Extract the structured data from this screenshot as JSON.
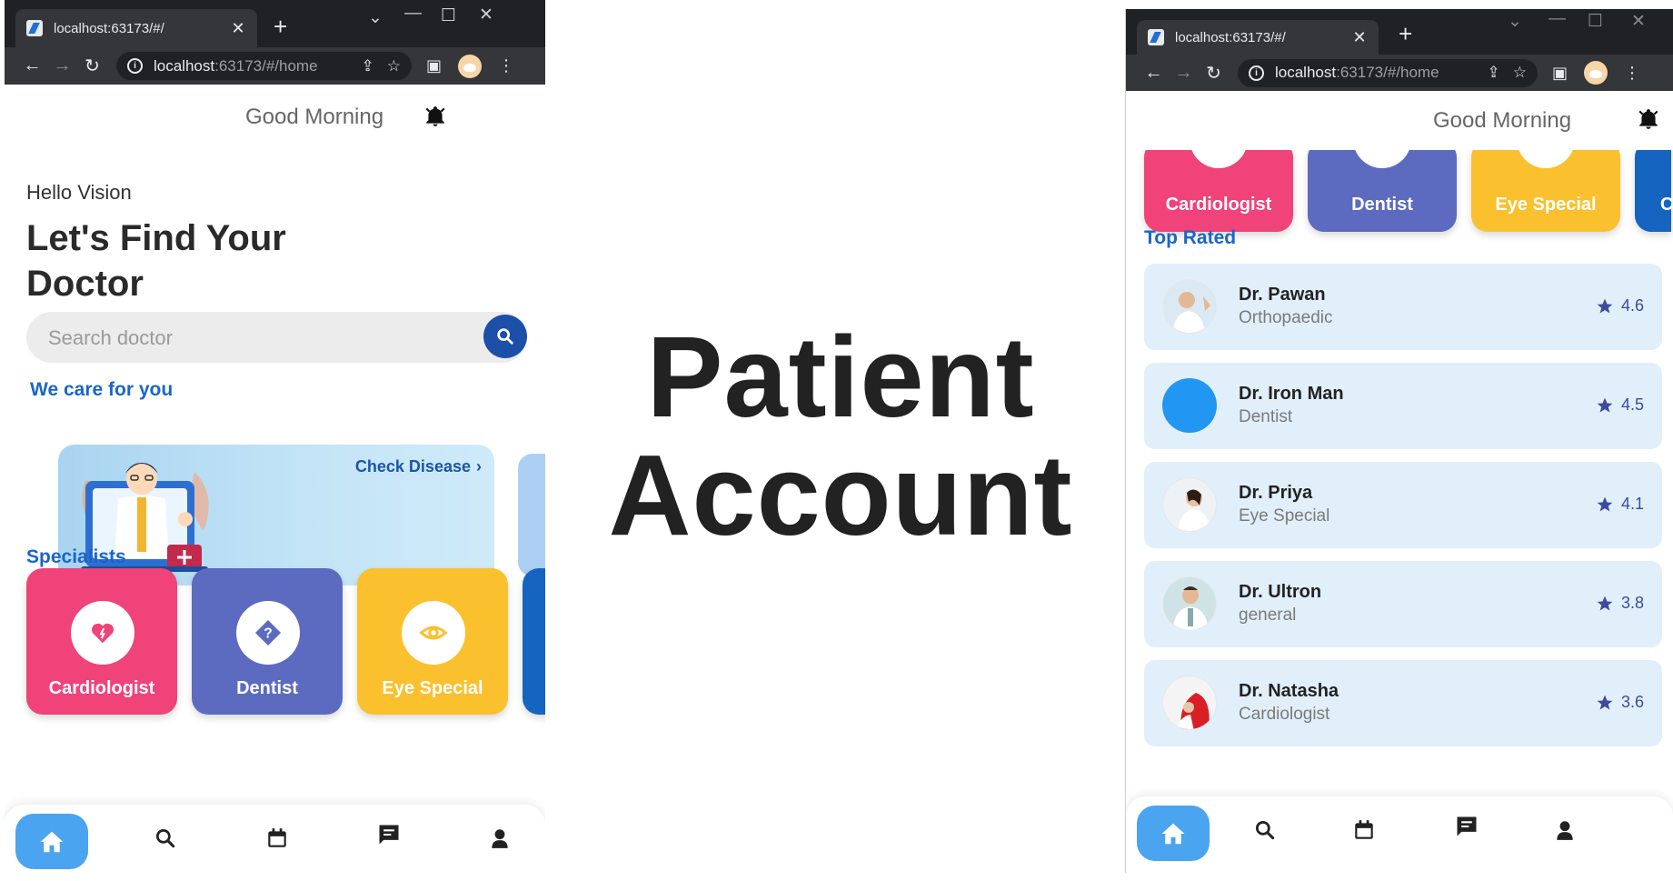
{
  "overlay_title": {
    "line1": "Patient",
    "line2": "Account"
  },
  "browser": {
    "tab_title": "localhost:63173/#/",
    "url_host": "localhost",
    "url_rest": ":63173/#/home"
  },
  "app": {
    "greeting": "Good Morning",
    "hello": "Hello Vision",
    "headline": "Let's Find Your Doctor",
    "search_placeholder": "Search doctor",
    "care_title": "We care for you",
    "check_disease": "Check Disease",
    "specialists_title": "Specialists",
    "specialists": [
      {
        "label": "Cardiologist",
        "color": "#ef4379"
      },
      {
        "label": "Dentist",
        "color": "#5c6bc0"
      },
      {
        "label": "Eye Special",
        "color": "#fbc02d"
      }
    ],
    "peek_spec_color": "#1565c0",
    "peek_label_fragment": "C",
    "top_rated_title": "Top Rated",
    "doctors": [
      {
        "name": "Dr. Pawan",
        "specialty": "Orthopaedic",
        "rating": "4.6"
      },
      {
        "name": "Dr. Iron Man",
        "specialty": "Dentist",
        "rating": "4.5"
      },
      {
        "name": "Dr. Priya",
        "specialty": "Eye Special",
        "rating": "4.1"
      },
      {
        "name": "Dr. Ultron",
        "specialty": "general",
        "rating": "3.8"
      },
      {
        "name": "Dr. Natasha",
        "specialty": "Cardiologist",
        "rating": "3.6"
      }
    ],
    "nav": [
      "home-icon",
      "search-icon",
      "appointments-icon",
      "chat-icon",
      "profile-icon"
    ]
  },
  "colors": {
    "accent": "#1b65c7",
    "search_button": "#1b4fa8",
    "home_nav": "#4aa4ef",
    "rating": "#3d4a9e",
    "doctor_card": "#e1effb"
  }
}
